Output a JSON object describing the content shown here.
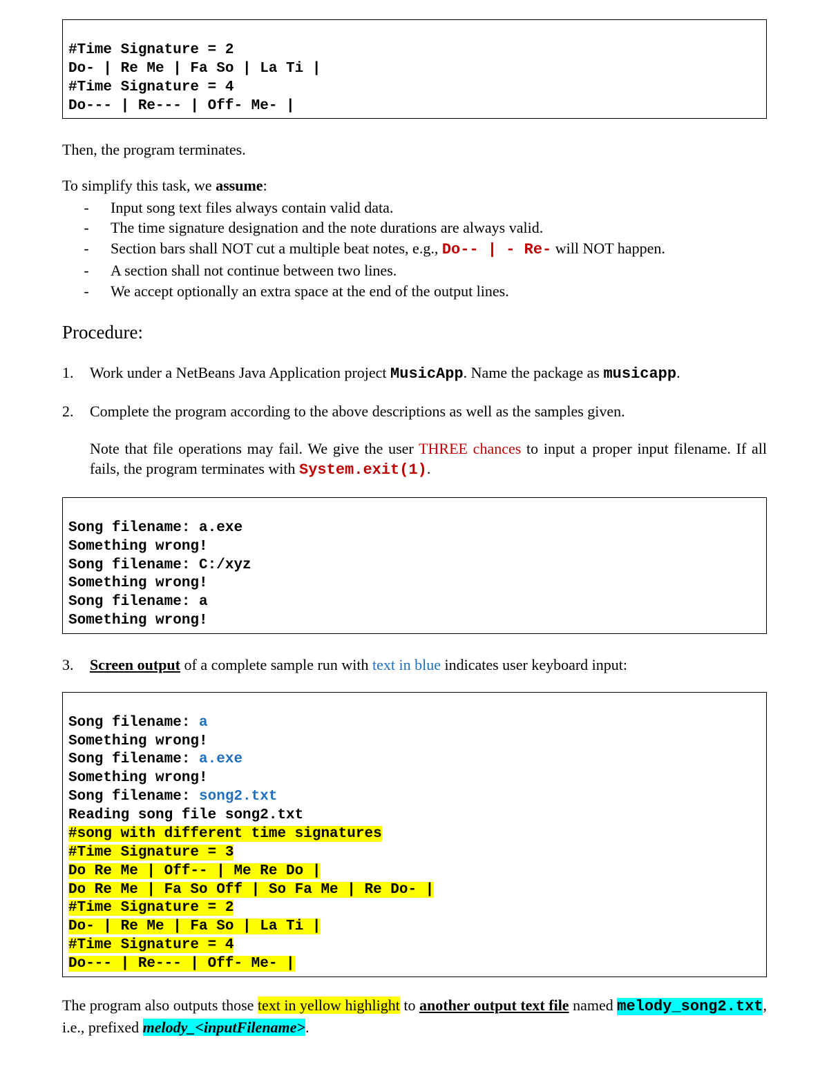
{
  "box1": {
    "l1": "#Time Signature = 2",
    "l2": "Do- | Re Me | Fa So | La Ti |",
    "l3": "#Time Signature = 4",
    "l4": "Do--- | Re--- | Off- Me- |"
  },
  "p_terminate": "Then, the program terminates.",
  "assume_intro_a": "To simplify this task, we ",
  "assume_intro_b": "assume",
  "assume_intro_c": ":",
  "bullets": {
    "b1": "Input song text files always contain valid data.",
    "b2": "The time signature designation and the note durations are always valid.",
    "b3_a": "Section bars shall NOT cut a multiple beat notes, e.g., ",
    "b3_code": "Do-- | - Re-",
    "b3_b": " will NOT happen.",
    "b4": "A section shall not continue between two lines.",
    "b5": "We accept optionally an extra space at the end of the output lines."
  },
  "procedure_h": "Procedure:",
  "step1_a": "Work under a NetBeans Java Application project ",
  "step1_code1": "MusicApp",
  "step1_b": ".  Name the package as ",
  "step1_code2": "musicapp",
  "step1_c": ".",
  "step2_a": "Complete the program according to the above descriptions as well as the samples given.",
  "step2_b1": "Note that file operations may fail.  We give the user ",
  "step2_three": "THREE chances",
  "step2_b2": " to input a proper input filename.  If all fails, the program terminates with ",
  "step2_exit": "System.exit(1)",
  "step2_b3": ".",
  "box2": {
    "l1": "Song filename: a.exe",
    "l2": "Something wrong!",
    "l3": "Song filename: C:/xyz",
    "l4": "Something wrong!",
    "l5": "Song filename: a",
    "l6": "Something wrong!"
  },
  "step3_a": "Screen output",
  "step3_b": " of a complete sample run with ",
  "step3_blue": "text in blue",
  "step3_c": " indicates user keyboard input:",
  "box3": {
    "p1a": "Song filename: ",
    "p1b": "a",
    "l2": "Something wrong!",
    "p3a": "Song filename: ",
    "p3b": "a.exe",
    "l4": "Something wrong!",
    "p5a": "Song filename: ",
    "p5b": "song2.txt",
    "l6": "Reading song file song2.txt",
    "l7": "#song with different time signatures",
    "l8": "#Time Signature = 3",
    "l9": "Do Re Me | Off-- | Me Re Do |",
    "l10": "Do Re Me | Fa So Off | So Fa Me | Re Do- |",
    "l11": "#Time Signature = 2",
    "l12": "Do- | Re Me | Fa So | La Ti |",
    "l13": "#Time Signature = 4",
    "l14": "Do--- | Re--- | Off- Me- |"
  },
  "final_a": "The program also outputs those ",
  "final_y": "text in yellow highlight",
  "final_b": " to ",
  "final_u": "another output text file",
  "final_c": " named ",
  "final_melody": "melody_song2.txt",
  "final_d": ", i.e., prefixed ",
  "final_pref": "melody_<inputFilename>",
  "final_e": "."
}
